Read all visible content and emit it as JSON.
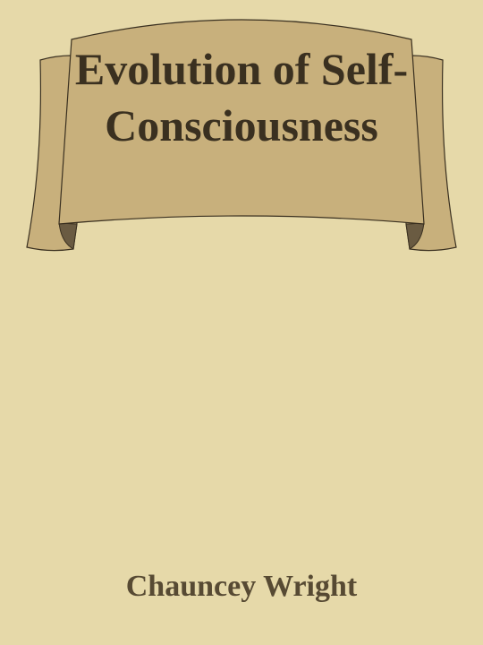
{
  "cover": {
    "title": "Evolution of Self-Consciousness",
    "author": "Chauncey Wright"
  },
  "colors": {
    "background": "#e6d9a9",
    "banner_fill": "#c8b07c",
    "banner_shadow": "#6a5b42",
    "banner_outline": "#3a3020",
    "title_text": "#3a3020",
    "author_text": "#574a33"
  }
}
